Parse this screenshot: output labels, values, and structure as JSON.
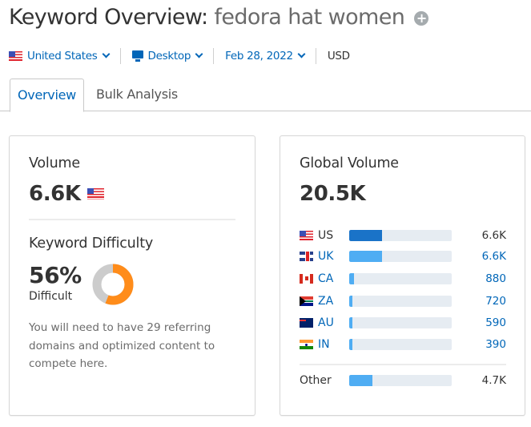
{
  "header": {
    "title": "Keyword Overview:",
    "keyword": "fedora hat women",
    "add_icon": "plus-circle-icon"
  },
  "filters": {
    "country": "United States",
    "device": "Desktop",
    "date": "Feb 28, 2022",
    "currency": "USD"
  },
  "tabs": [
    {
      "label": "Overview",
      "active": true
    },
    {
      "label": "Bulk Analysis",
      "active": false
    }
  ],
  "volume": {
    "label": "Volume",
    "value": "6.6K",
    "flag": "us-flag-icon"
  },
  "difficulty": {
    "label": "Keyword Difficulty",
    "value": "56%",
    "percent": 56,
    "level": "Difficult",
    "description": "You will need to have 29 referring domains and optimized content to compete here.",
    "colors": {
      "filled": "#ff8c1a",
      "empty": "#cccccc"
    }
  },
  "global_volume": {
    "label": "Global Volume",
    "value": "20.5K",
    "rows": [
      {
        "code": "US",
        "value": "6.6K",
        "share": 0.32,
        "flag": "us",
        "link": false,
        "bar_color": "#1a73c8"
      },
      {
        "code": "UK",
        "value": "6.6K",
        "share": 0.32,
        "flag": "uk",
        "link": true,
        "bar_color": "#4fadf3"
      },
      {
        "code": "CA",
        "value": "880",
        "share": 0.043,
        "flag": "ca",
        "link": true,
        "bar_color": "#4fadf3"
      },
      {
        "code": "ZA",
        "value": "720",
        "share": 0.035,
        "flag": "za",
        "link": true,
        "bar_color": "#4fadf3"
      },
      {
        "code": "AU",
        "value": "590",
        "share": 0.029,
        "flag": "au",
        "link": true,
        "bar_color": "#4fadf3"
      },
      {
        "code": "IN",
        "value": "390",
        "share": 0.019,
        "flag": "in",
        "link": true,
        "bar_color": "#4fadf3"
      }
    ],
    "other": {
      "label": "Other",
      "value": "4.7K",
      "share": 0.23,
      "bar_color": "#4fadf3"
    }
  }
}
